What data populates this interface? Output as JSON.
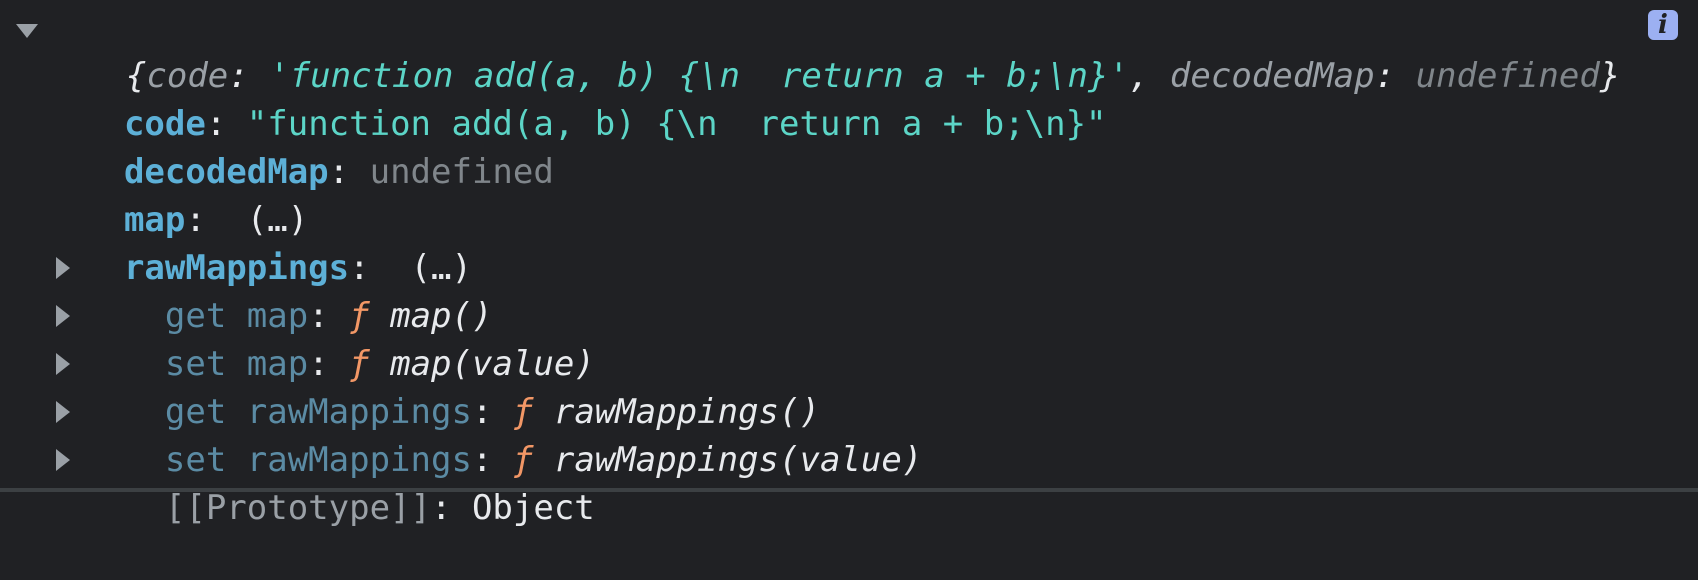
{
  "summary": {
    "open_brace": "{",
    "key_code": "code",
    "colon": ": ",
    "code_value": "'function add(a, b) {\\n  return a + b;\\n}'",
    "comma": ", ",
    "key_decoded": "decodedMap",
    "colon2": ": ",
    "decoded_value": "undefined",
    "close_brace": "}",
    "info_label": "i"
  },
  "properties": [
    {
      "key": "code",
      "sep": ": ",
      "value": "\"function add(a, b) {\\n  return a + b;\\n}\""
    },
    {
      "key": "decodedMap",
      "sep": ": ",
      "value": "undefined"
    },
    {
      "key": "map",
      "sep": ":  ",
      "value": "(…)"
    },
    {
      "key": "rawMappings",
      "sep": ":  ",
      "value": "(…)"
    }
  ],
  "accessors": [
    {
      "label": "get map",
      "sep": ": ",
      "f": "ƒ",
      "fn": " map()"
    },
    {
      "label": "set map",
      "sep": ": ",
      "f": "ƒ",
      "fn": " map(value)"
    },
    {
      "label": "get rawMappings",
      "sep": ": ",
      "f": "ƒ",
      "fn": " rawMappings()"
    },
    {
      "label": "set rawMappings",
      "sep": ": ",
      "f": "ƒ",
      "fn": " rawMappings(value)"
    }
  ],
  "prototype": {
    "label": "[[Prototype]]",
    "sep": ": ",
    "value": "Object"
  },
  "colors": {
    "background": "#202124",
    "key": "#5db0d7",
    "string": "#5cd5c7",
    "undefined": "#80868b",
    "function_f": "#f29766",
    "accessor": "#5b8ba4"
  }
}
